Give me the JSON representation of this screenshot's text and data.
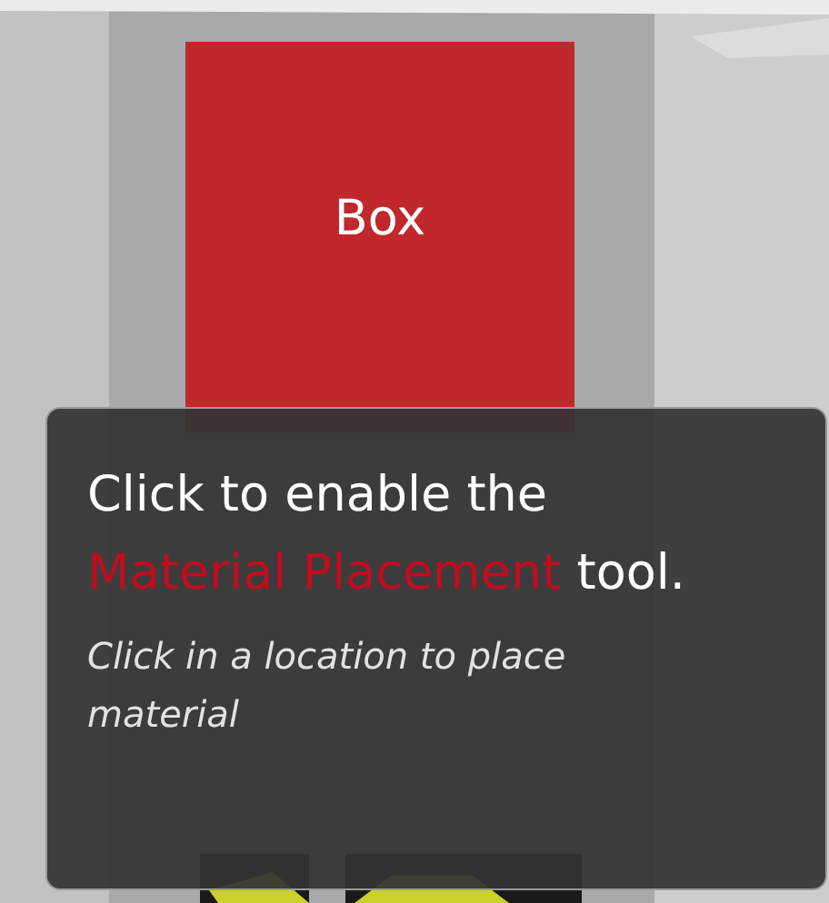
{
  "tool_button": {
    "label": "Box"
  },
  "tooltip": {
    "title_before": "Click to enable the",
    "title_highlight": "Material Placement",
    "title_after": "tool.",
    "hint": "Click in a location to place material"
  }
}
